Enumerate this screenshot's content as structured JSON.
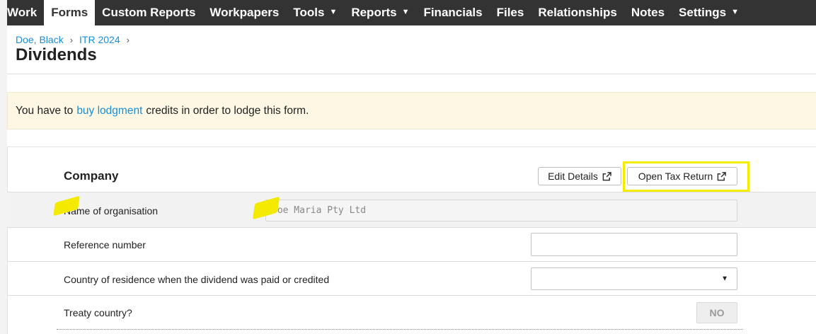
{
  "topnav": {
    "items": [
      {
        "label": "Work",
        "dropdown": false
      },
      {
        "label": "Forms",
        "dropdown": false,
        "active": true
      },
      {
        "label": "Custom Reports",
        "dropdown": false
      },
      {
        "label": "Workpapers",
        "dropdown": false
      },
      {
        "label": "Tools",
        "dropdown": true
      },
      {
        "label": "Reports",
        "dropdown": true
      },
      {
        "label": "Financials",
        "dropdown": false
      },
      {
        "label": "Files",
        "dropdown": false
      },
      {
        "label": "Relationships",
        "dropdown": false
      },
      {
        "label": "Notes",
        "dropdown": false
      },
      {
        "label": "Settings",
        "dropdown": true
      }
    ]
  },
  "breadcrumb": {
    "items": [
      "Doe, Black",
      "ITR 2024"
    ],
    "separator": "›"
  },
  "page": {
    "title": "Dividends"
  },
  "alert": {
    "text_before": "You have to",
    "link": "buy lodgment",
    "text_after": "credits in order to lodge this form."
  },
  "company": {
    "section_title": "Company",
    "edit_details_label": "Edit Details",
    "open_tax_return_label": "Open Tax Return",
    "fields": {
      "name_of_organisation": {
        "label": "Name of organisation",
        "value": "Doe Maria Pty Ltd"
      },
      "reference_number": {
        "label": "Reference number",
        "value": ""
      },
      "country_of_residence": {
        "label": "Country of residence when the dividend was paid or credited",
        "value": ""
      },
      "treaty_country": {
        "label": "Treaty country?",
        "value": "NO"
      }
    }
  },
  "colors": {
    "nav_bg": "#333333",
    "link": "#1a8fd6",
    "alert_bg": "#fdf7e3",
    "highlight": "#f5ec00"
  },
  "icons": {
    "nav_dropdown": "caret-down-icon",
    "external_link": "external-link-icon",
    "select_dropdown": "caret-down-icon"
  }
}
